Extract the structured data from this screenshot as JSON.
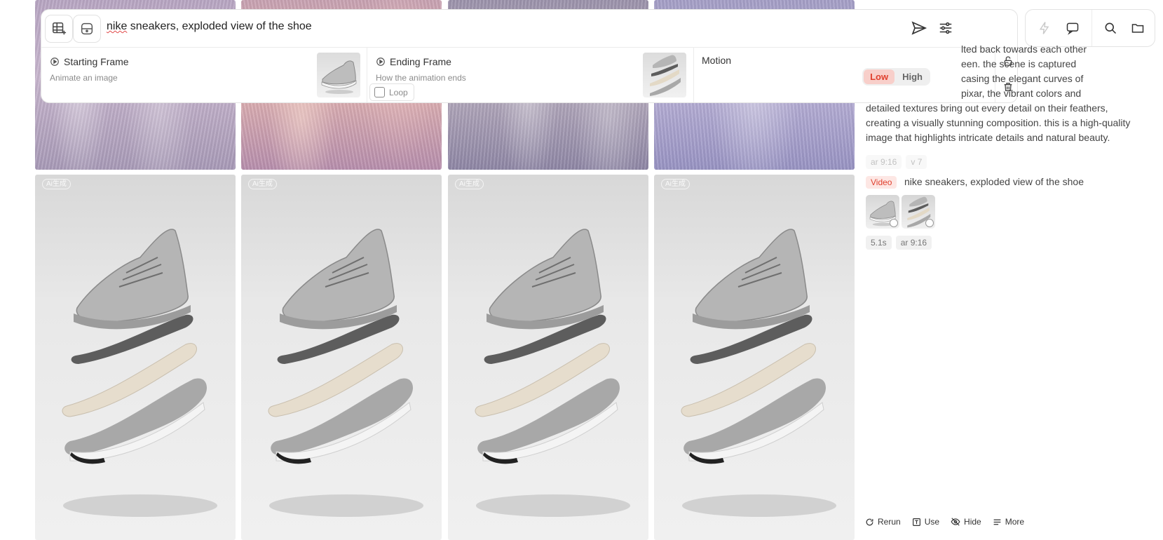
{
  "prompt": {
    "first_word": "nike",
    "rest": " sneakers, exploded view of the shoe"
  },
  "starting_frame": {
    "title": "Starting Frame",
    "subtitle": "Animate an image"
  },
  "ending_frame": {
    "title": "Ending Frame",
    "subtitle": "How the animation ends",
    "loop_label": "Loop"
  },
  "motion": {
    "title": "Motion",
    "low": "Low",
    "high": "High"
  },
  "watermark": "Ai生成",
  "info": {
    "description_visible": "lted back towards each other een. the scene is captured casing the elegant curves of pixar, the vibrant colors and detailed textures bring out every detail on their feathers, creating a visually stunning composition. this is a high-quality image that highlights intricate details and natural beauty.",
    "desc_lines": [
      "lted back towards each other",
      "een. the scene is captured",
      "casing the elegant curves of",
      "pixar, the vibrant colors and",
      "detailed textures bring out every detail on their feathers,",
      "creating a visually stunning composition. this is a high-quality",
      "image that highlights intricate details and natural beauty."
    ],
    "tags1": [
      "ar 9:16",
      "v 7"
    ],
    "video_badge": "Video",
    "video_title": "nike sneakers, exploded view of the shoe",
    "tags2": [
      "5.1s",
      "ar 9:16"
    ]
  },
  "actions": {
    "rerun": "Rerun",
    "use": "Use",
    "hide": "Hide",
    "more": "More"
  },
  "colors": {
    "accent": "#e0412f",
    "accent_bg": "#f8cfca",
    "border": "#e3e3e3"
  }
}
